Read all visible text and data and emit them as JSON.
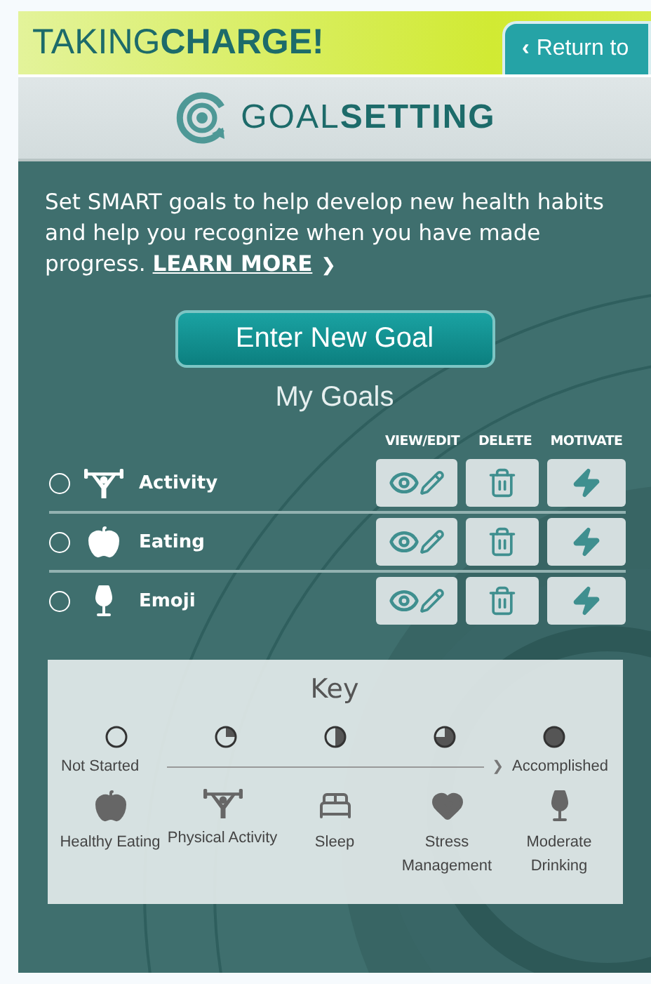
{
  "brand": "TAKING**CHARGE!**",
  "return_tab": {
    "chevron": "‹",
    "label": "Return to"
  },
  "app_title": "GOAL**SETTING**",
  "intro": {
    "text": "Set SMART goals to help develop new health habits and help you recognize when you have made progress.",
    "link": "LEARN MORE",
    "link_arrow": "❯"
  },
  "new_goal_button": "Enter New Goal",
  "goals": {
    "title": "My Goals",
    "columns": [
      "VIEW/EDIT",
      "DELETE",
      "MOTIVATE"
    ],
    "rows": [
      {
        "name": "Activity",
        "kind": "activity",
        "selected": false
      },
      {
        "name": "Eating",
        "kind": "eating",
        "selected": false
      },
      {
        "name": "Emoji",
        "kind": "drinking",
        "selected": false
      }
    ]
  },
  "key": {
    "title": "Key",
    "start_label": "Not Started",
    "end_label": "Accomplished",
    "arrow": "❯",
    "stages": [
      {
        "kind": "empty"
      },
      {
        "kind": "quarter"
      },
      {
        "kind": "half"
      },
      {
        "kind": "three_quarter"
      },
      {
        "kind": "full"
      }
    ],
    "categories": [
      {
        "label": "Healthy Eating",
        "kind": "eating"
      },
      {
        "label": "Physical Activity",
        "kind": "activity"
      },
      {
        "label": "Sleep",
        "kind": "sleep"
      },
      {
        "label": "Stress Management",
        "kind": "stress"
      },
      {
        "label": "Moderate Drinking",
        "kind": "drinking"
      }
    ]
  }
}
